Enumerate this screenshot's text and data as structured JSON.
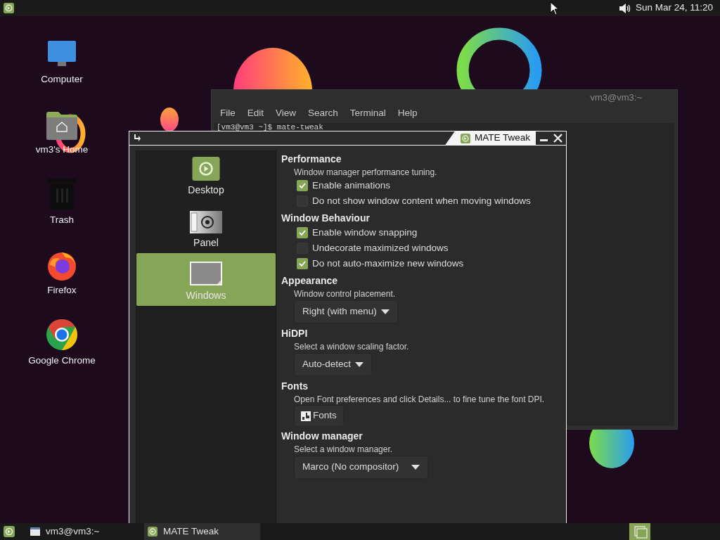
{
  "top_panel": {
    "clock": "Sun Mar 24, 11:20"
  },
  "desktop_icons": [
    {
      "kind": "computer",
      "label": "Computer"
    },
    {
      "kind": "home",
      "label": "vm3's Home"
    },
    {
      "kind": "trash",
      "label": "Trash"
    },
    {
      "kind": "firefox",
      "label": "Firefox"
    },
    {
      "kind": "chrome",
      "label": "Google Chrome"
    }
  ],
  "terminal": {
    "title": "vm3@vm3:~",
    "menu": [
      "File",
      "Edit",
      "View",
      "Search",
      "Terminal",
      "Help"
    ],
    "line": "[vm3@vm3 ~]$ mate-tweak"
  },
  "tweak_window": {
    "title": "MATE Tweak",
    "sidebar": [
      {
        "kind": "desktop",
        "label": "Desktop",
        "selected": false
      },
      {
        "kind": "panel",
        "label": "Panel",
        "selected": false
      },
      {
        "kind": "windows",
        "label": "Windows",
        "selected": true
      }
    ],
    "sections": [
      {
        "title": "Performance",
        "description": "Window manager performance tuning.",
        "items": [
          {
            "kind": "checkbox",
            "label": "Enable animations",
            "checked": true
          },
          {
            "kind": "checkbox",
            "label": "Do not show window content when moving windows",
            "checked": false
          }
        ]
      },
      {
        "title": "Window Behaviour",
        "items": [
          {
            "kind": "checkbox",
            "label": "Enable window snapping",
            "checked": true
          },
          {
            "kind": "checkbox",
            "label": "Undecorate maximized windows",
            "checked": false
          },
          {
            "kind": "checkbox",
            "label": "Do not auto-maximize new windows",
            "checked": true
          }
        ]
      },
      {
        "title": "Appearance",
        "description": "Window control placement.",
        "items": [
          {
            "kind": "dropdown",
            "value": "Right (with menu)"
          }
        ]
      },
      {
        "title": "HiDPI",
        "description": "Select a window scaling factor.",
        "items": [
          {
            "kind": "dropdown",
            "value": "Auto-detect"
          }
        ]
      },
      {
        "title": "Fonts",
        "description": "Open Font preferences and click Details... to fine tune the font DPI.",
        "items": [
          {
            "kind": "button",
            "label": "Fonts"
          }
        ]
      },
      {
        "title": "Window manager",
        "description": "Select a window manager.",
        "items": [
          {
            "kind": "dropdown",
            "value": "Marco (No compositor)",
            "wide": true
          }
        ]
      }
    ]
  },
  "taskbar": [
    {
      "kind": "terminal",
      "label": "vm3@vm3:~",
      "selected": false
    },
    {
      "kind": "tweak",
      "label": "MATE Tweak",
      "selected": true
    }
  ]
}
